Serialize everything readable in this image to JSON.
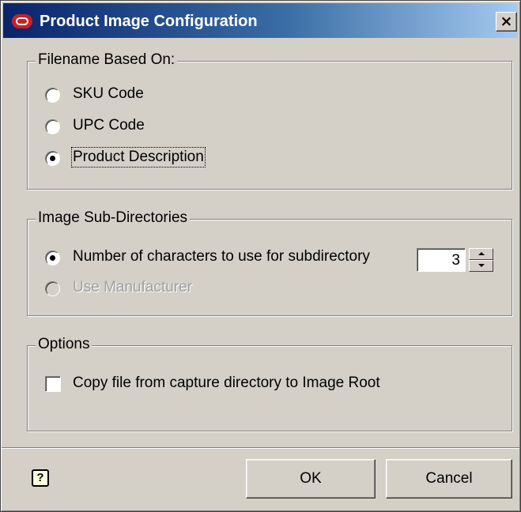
{
  "window": {
    "title": "Product Image Configuration",
    "close_glyph": "×"
  },
  "filename_group": {
    "legend": "Filename Based On:",
    "options": [
      {
        "label": "SKU Code",
        "selected": false
      },
      {
        "label": "UPC Code",
        "selected": false
      },
      {
        "label": "Product Description",
        "selected": true
      }
    ]
  },
  "subdir_group": {
    "legend": "Image Sub-Directories",
    "options": [
      {
        "label": "Number of characters to use for subdirectory",
        "selected": true,
        "enabled": true
      },
      {
        "label": "Use Manufacturer",
        "selected": false,
        "enabled": false
      }
    ],
    "spinner_value": "3"
  },
  "options_group": {
    "legend": "Options",
    "checkbox_label": "Copy file from capture directory to Image Root",
    "checked": false
  },
  "footer": {
    "help_glyph": "?",
    "ok_label": "OK",
    "cancel_label": "Cancel"
  },
  "colors": {
    "title_gradient_start": "#0a246a",
    "title_gradient_end": "#a6caf0",
    "dialog_background": "#d4d0c8",
    "app_icon": "#d11e1e"
  }
}
